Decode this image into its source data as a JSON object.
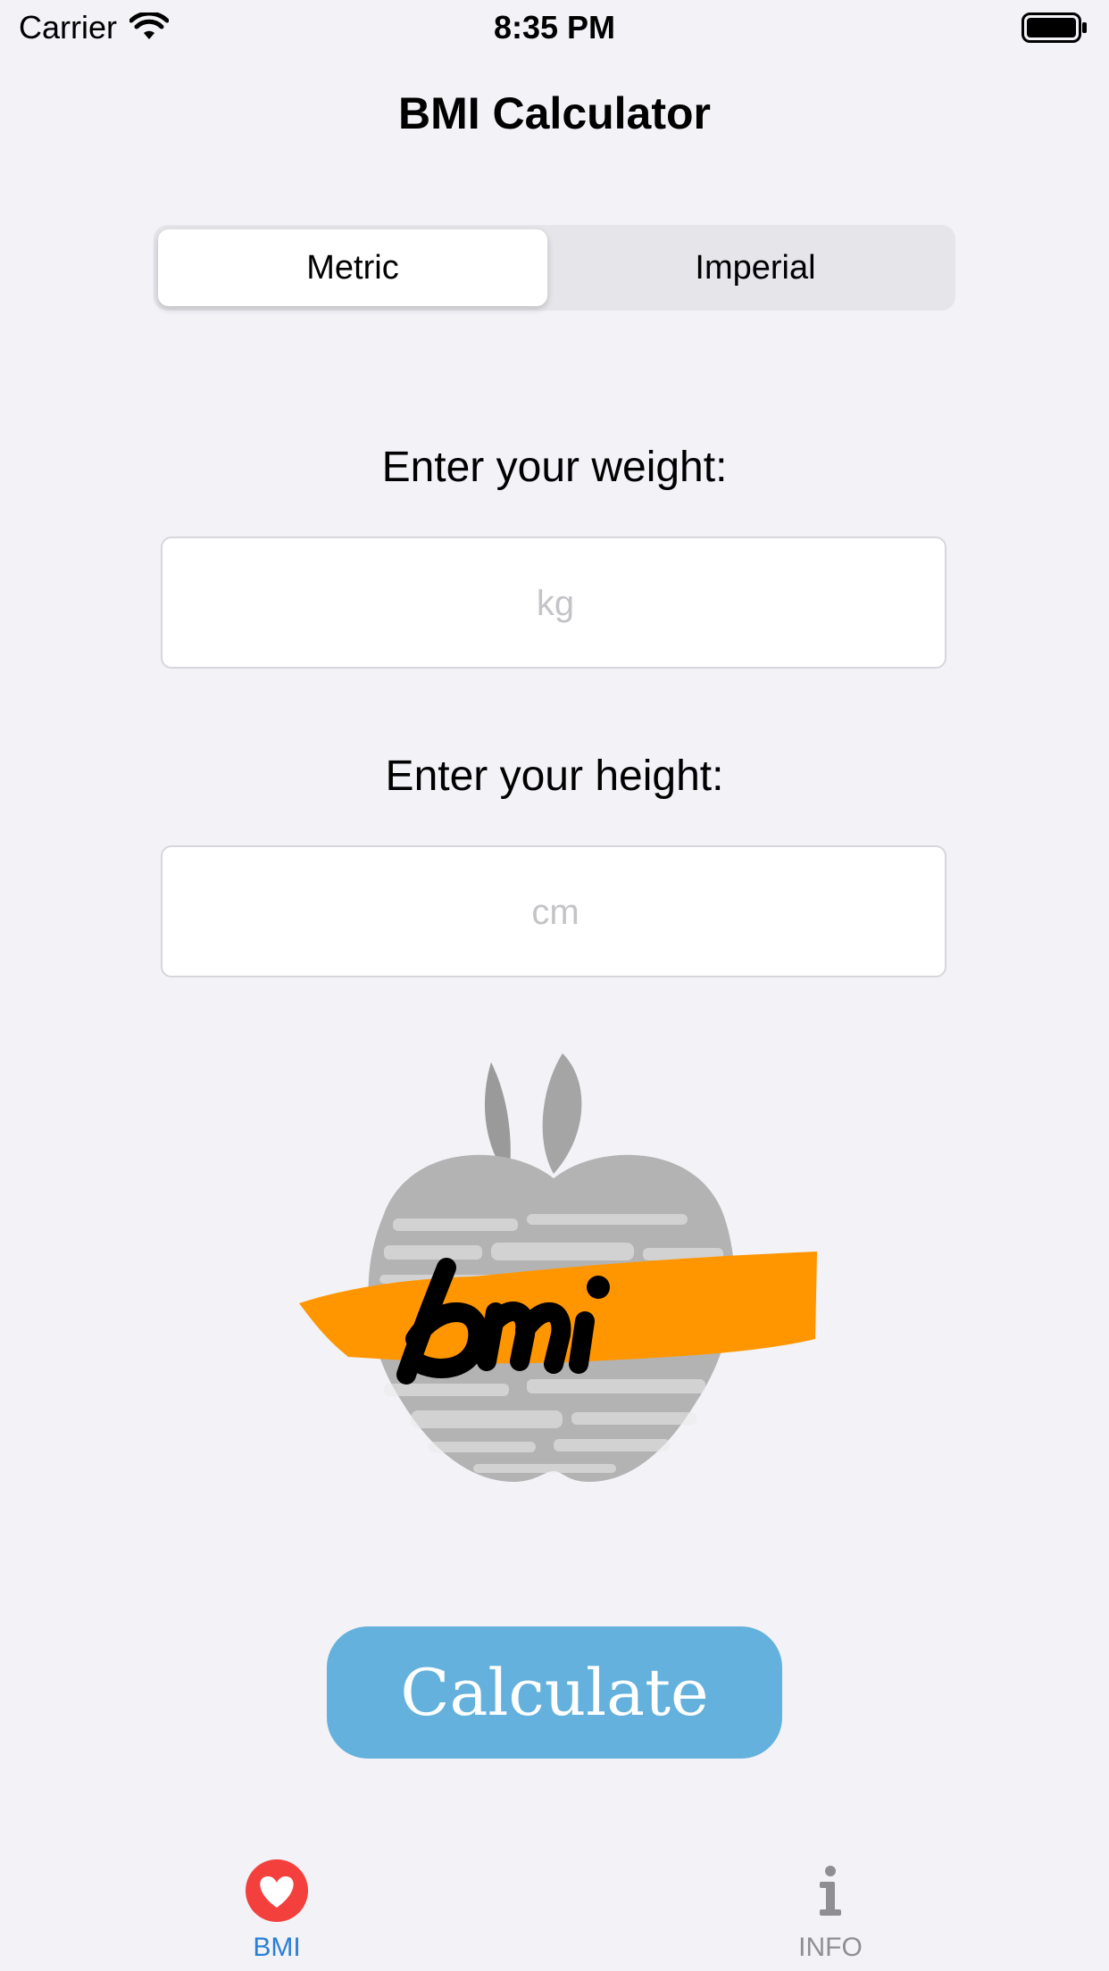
{
  "status": {
    "carrier": "Carrier",
    "time": "8:35 PM"
  },
  "nav": {
    "title": "BMI Calculator"
  },
  "units": {
    "options": [
      "Metric",
      "Imperial"
    ],
    "selected": "Metric"
  },
  "weight": {
    "label": "Enter your weight:",
    "placeholder": "kg",
    "value": ""
  },
  "height": {
    "label": "Enter your height:",
    "placeholder": "cm",
    "value": ""
  },
  "logo": {
    "text": "bmi"
  },
  "calculate": {
    "label": "Calculate"
  },
  "tabs": [
    {
      "label": "BMI",
      "icon": "heart-icon",
      "selected": true
    },
    {
      "label": "INFO",
      "icon": "info-icon",
      "selected": false
    }
  ],
  "colors": {
    "accent": "#2a7fd6",
    "button": "#63b1dc",
    "heart": "#f4403d",
    "stroke": "#ff9600"
  }
}
